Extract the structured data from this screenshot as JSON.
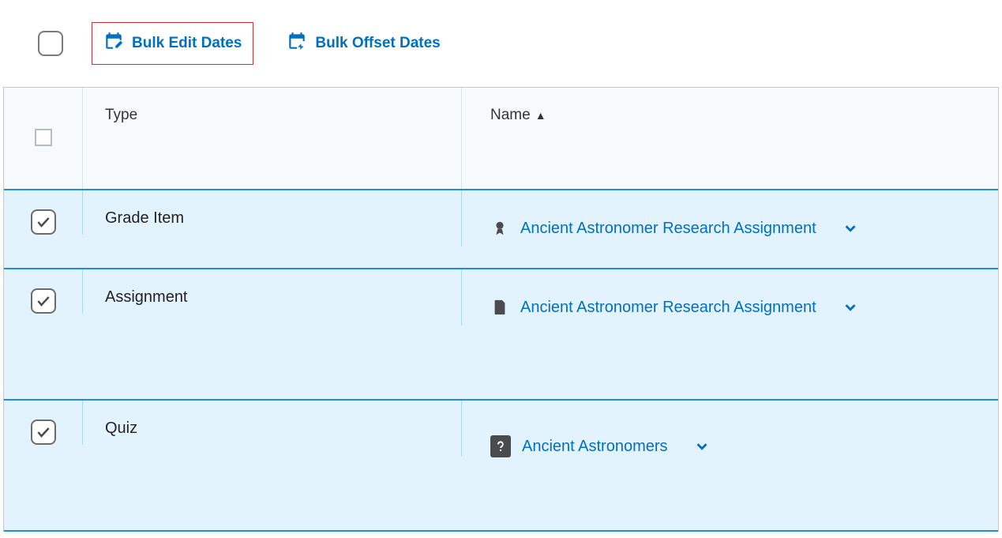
{
  "toolbar": {
    "bulk_edit_label": "Bulk Edit Dates",
    "bulk_offset_label": "Bulk Offset Dates"
  },
  "columns": {
    "type_label": "Type",
    "name_label": "Name"
  },
  "rows": [
    {
      "checked": true,
      "type": "Grade Item",
      "icon": "ribbon",
      "name": "Ancient Astronomer Research Assignment"
    },
    {
      "checked": true,
      "type": "Assignment",
      "icon": "document",
      "name": "Ancient Astronomer Research Assignment"
    },
    {
      "checked": true,
      "type": "Quiz",
      "icon": "question",
      "name": "Ancient Astronomers"
    }
  ]
}
